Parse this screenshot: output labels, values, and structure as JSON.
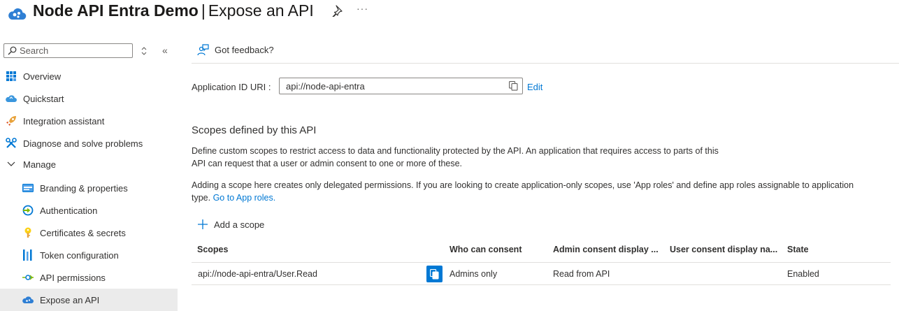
{
  "header": {
    "app_name": "Node API Entra Demo",
    "separator": "|",
    "page_name": "Expose an API",
    "more_label": "···"
  },
  "sidebar": {
    "search_placeholder": "Search",
    "collapse_label": "«",
    "items": [
      {
        "label": "Overview",
        "icon": "overview-grid-icon"
      },
      {
        "label": "Quickstart",
        "icon": "quickstart-cloud-icon"
      },
      {
        "label": "Integration assistant",
        "icon": "rocket-icon"
      },
      {
        "label": "Diagnose and solve problems",
        "icon": "wrench-icon"
      },
      {
        "label": "Manage",
        "icon": "chevron-down-icon"
      },
      {
        "label": "Branding & properties",
        "icon": "branding-card-icon"
      },
      {
        "label": "Authentication",
        "icon": "authentication-icon"
      },
      {
        "label": "Certificates & secrets",
        "icon": "key-icon"
      },
      {
        "label": "Token configuration",
        "icon": "token-bars-icon"
      },
      {
        "label": "API permissions",
        "icon": "api-permissions-icon"
      },
      {
        "label": "Expose an API",
        "icon": "expose-api-cloud-icon"
      }
    ],
    "active_item": "Expose an API"
  },
  "main": {
    "feedback_label": "Got feedback?",
    "app_id_label": "Application ID URI :",
    "app_id_value": "api://node-api-entra",
    "edit_label": "Edit",
    "scopes_heading": "Scopes defined by this API",
    "desc1_line1": "Define custom scopes to restrict access to data and functionality protected by the API. An application that requires access to parts of this",
    "desc1_line2": "API can request that a user or admin consent to one or more of these.",
    "desc2_line1": "Adding a scope here creates only delegated permissions. If you are looking to create application-only scopes, use 'App roles' and define app roles assignable to application",
    "desc2_line2_prefix": "type. ",
    "desc2_link": "Go to App roles.",
    "add_scope_label": "Add a scope",
    "table": {
      "headers": [
        "Scopes",
        "Who can consent",
        "Admin consent display ...",
        "User consent display na...",
        "State"
      ],
      "rows": [
        {
          "scope": "api://node-api-entra/User.Read",
          "who": "Admins only",
          "admin_display": "Read from API",
          "user_display": "",
          "state": "Enabled"
        }
      ]
    }
  },
  "colors": {
    "accent": "#0078d4",
    "active_nav_bg": "#ebebeb",
    "divider": "#e1dfdd"
  }
}
